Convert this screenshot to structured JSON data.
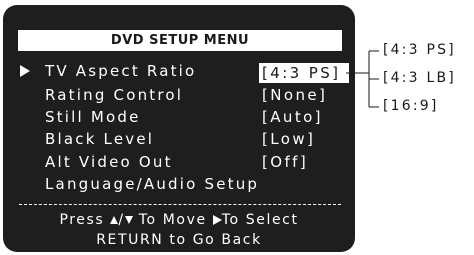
{
  "menu": {
    "title": "DVD SETUP MENU",
    "items": [
      {
        "label": "TV Aspect Ratio",
        "value": "[4:3 PS]"
      },
      {
        "label": "Rating Control",
        "value": "[None]"
      },
      {
        "label": "Still Mode",
        "value": "[Auto]"
      },
      {
        "label": "Black Level",
        "value": "[Low]"
      },
      {
        "label": "Alt Video Out",
        "value": "[Off]"
      },
      {
        "label": "Language/Audio Setup",
        "value": ""
      }
    ],
    "divider": "- - - - - - - - - - - - - - - - - - - - - - - -"
  },
  "footer": {
    "press": "Press",
    "slash": "/",
    "to_move": "To Move",
    "to_select": "To Select",
    "return_line": "RETURN to Go Back"
  },
  "options": [
    "[4:3 PS]",
    "[4:3 LB]",
    "[16:9]"
  ],
  "colors": {
    "screen_bg": "#1e1e1e",
    "text": "#ffffff",
    "highlight_bg": "#ffffff",
    "highlight_text": "#1a1a1a"
  },
  "icons": {
    "cursor": "right-triangle-icon",
    "up": "up-triangle-icon",
    "down": "down-triangle-icon",
    "select": "right-triangle-icon"
  }
}
